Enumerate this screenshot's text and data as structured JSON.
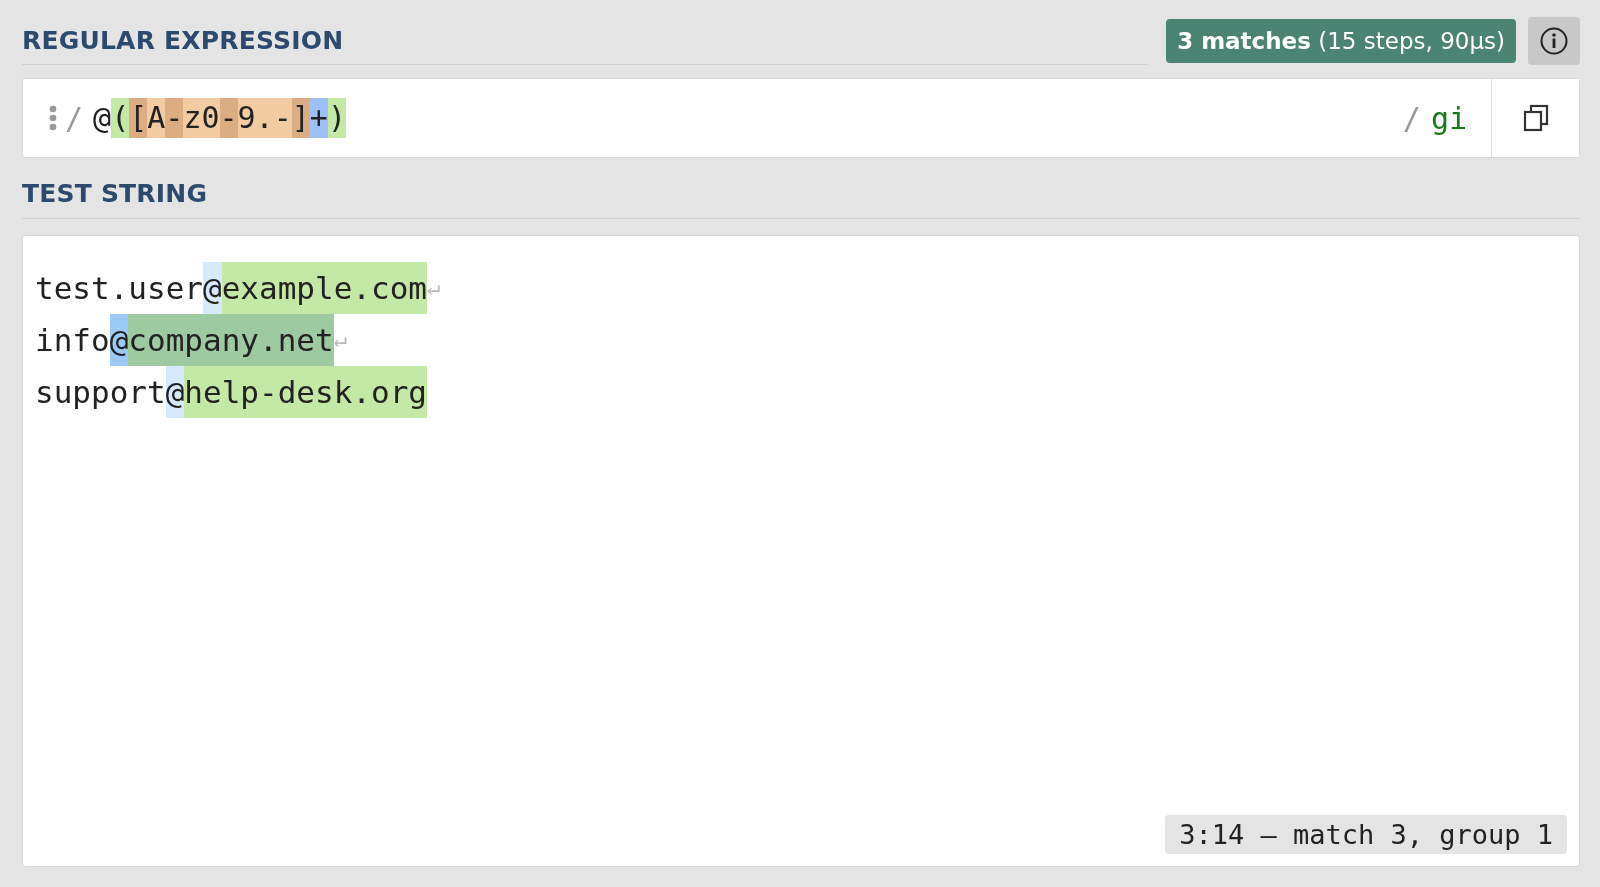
{
  "regex_section": {
    "heading": "REGULAR EXPRESSION",
    "match_badge": {
      "count": "3 matches",
      "detail": "(15 steps, 90µs)"
    },
    "delimiter_open": "/",
    "flags_delimiter": "/",
    "flags": "gi",
    "tokens": [
      {
        "kind": "plain",
        "text": "@"
      },
      {
        "kind": "group",
        "text": "("
      },
      {
        "kind": "class-edge",
        "text": "["
      },
      {
        "kind": "class",
        "text": "A"
      },
      {
        "kind": "class-range",
        "text": "-"
      },
      {
        "kind": "class",
        "text": "z0"
      },
      {
        "kind": "class-range",
        "text": "-"
      },
      {
        "kind": "class",
        "text": "9.-"
      },
      {
        "kind": "class-edge",
        "text": "]"
      },
      {
        "kind": "quantifier",
        "text": "+"
      },
      {
        "kind": "group",
        "text": ")"
      }
    ]
  },
  "test_section": {
    "heading": "TEST STRING",
    "lines": [
      {
        "prefix": "test.user",
        "at": "@",
        "group": "example.com",
        "eol": "↵",
        "selected": false
      },
      {
        "prefix": "info",
        "at": "@",
        "group": "company.net",
        "eol": "↵",
        "selected": true
      },
      {
        "prefix": "support",
        "at": "@",
        "group": "help-desk.org",
        "selected": false
      }
    ],
    "status": "3:14 — match 3, group 1"
  }
}
